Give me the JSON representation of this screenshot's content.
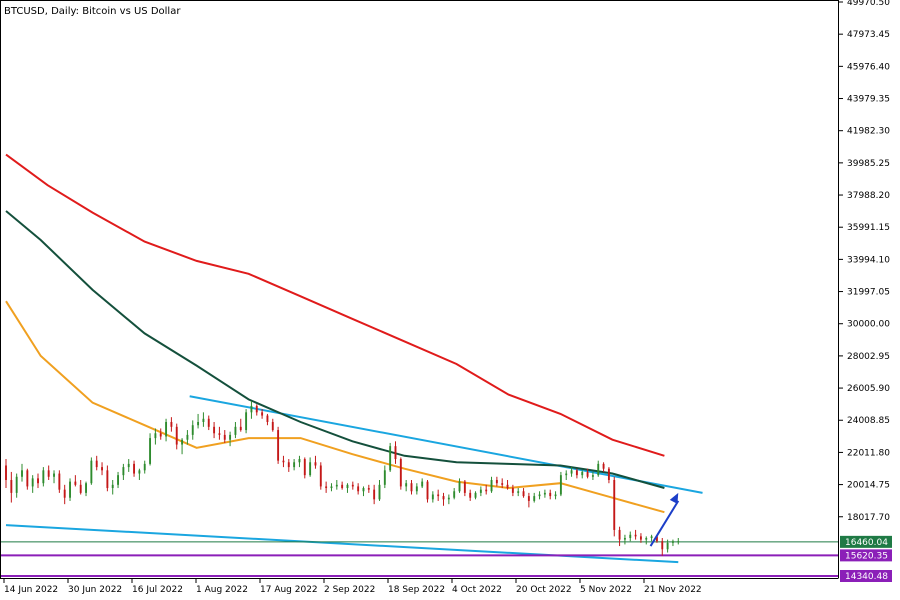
{
  "chart_data": {
    "type": "candlestick",
    "title": "BTCUSD, Daily:  Bitcoin vs US Dollar",
    "ylim": [
      14340.48,
      49970.5
    ],
    "grid": false,
    "y_ticks": [
      "49970.50",
      "47973.45",
      "45976.40",
      "43979.35",
      "41982.30",
      "39985.25",
      "37988.20",
      "35991.15",
      "33994.10",
      "31997.05",
      "30000.00",
      "28002.95",
      "26005.90",
      "24008.85",
      "22011.80",
      "20014.75",
      "18017.70"
    ],
    "x_tick_labels": [
      "14 Jun 2022",
      "30 Jun 2022",
      "16 Jul 2022",
      "1 Aug 2022",
      "17 Aug 2022",
      "2 Sep 2022",
      "18 Sep 2022",
      "4 Oct 2022",
      "20 Oct 2022",
      "5 Nov 2022",
      "21 Nov 2022"
    ],
    "price_labels": [
      {
        "text": "16460.04",
        "value": 16460.04,
        "color": "#1f7a45"
      },
      {
        "text": "15620.35",
        "value": 15620.35,
        "color": "#8b1fb8"
      },
      {
        "text": "14340.48",
        "value": 14340.48,
        "color": "#8b1fb8"
      }
    ],
    "colors": {
      "bull": "#2e8b2e",
      "bear": "#c41818",
      "ma_red": "#e01b1b",
      "ma_dark": "#14503c",
      "ma_orange": "#f0a020",
      "trend": "#1aa6e0",
      "arrow": "#1c3ec8"
    },
    "candles_ohlc": [
      [
        21200,
        21600,
        19800,
        20300
      ],
      [
        20300,
        20800,
        18900,
        19500
      ],
      [
        19500,
        20700,
        19200,
        20500
      ],
      [
        20500,
        21300,
        20200,
        20900
      ],
      [
        20900,
        21000,
        19700,
        19900
      ],
      [
        19900,
        20600,
        19500,
        20400
      ],
      [
        20400,
        20700,
        19800,
        20100
      ],
      [
        20100,
        21100,
        19900,
        20900
      ],
      [
        20900,
        21200,
        20300,
        20500
      ],
      [
        20500,
        20900,
        20100,
        20700
      ],
      [
        20700,
        20900,
        19500,
        19700
      ],
      [
        19700,
        20000,
        18800,
        19200
      ],
      [
        19200,
        20400,
        19000,
        20200
      ],
      [
        20200,
        20600,
        19900,
        20000
      ],
      [
        20000,
        20300,
        19400,
        19500
      ],
      [
        19500,
        20200,
        19300,
        20100
      ],
      [
        20100,
        21700,
        20000,
        21500
      ],
      [
        21500,
        21800,
        20900,
        21100
      ],
      [
        21100,
        21400,
        20600,
        20900
      ],
      [
        20900,
        21200,
        19600,
        19800
      ],
      [
        19800,
        20300,
        19400,
        20000
      ],
      [
        20000,
        20800,
        19800,
        20600
      ],
      [
        20600,
        21300,
        20300,
        21100
      ],
      [
        21100,
        21600,
        20800,
        21300
      ],
      [
        21300,
        21500,
        20500,
        20700
      ],
      [
        20700,
        21000,
        20300,
        20900
      ],
      [
        20900,
        21500,
        20700,
        21300
      ],
      [
        21300,
        23200,
        21200,
        22900
      ],
      [
        22900,
        23500,
        22500,
        23200
      ],
      [
        23200,
        23500,
        22800,
        23000
      ],
      [
        23000,
        24100,
        22700,
        23900
      ],
      [
        23900,
        24200,
        23300,
        23600
      ],
      [
        23600,
        23800,
        22200,
        22500
      ],
      [
        22500,
        22900,
        21900,
        22800
      ],
      [
        22800,
        23400,
        22500,
        23100
      ],
      [
        23100,
        24000,
        22800,
        23700
      ],
      [
        23700,
        24400,
        23500,
        23900
      ],
      [
        23900,
        24500,
        23600,
        24100
      ],
      [
        24100,
        24300,
        23400,
        23600
      ],
      [
        23600,
        23900,
        22900,
        23200
      ],
      [
        23200,
        23600,
        22800,
        23100
      ],
      [
        23100,
        23400,
        22600,
        22800
      ],
      [
        22800,
        23300,
        22400,
        23100
      ],
      [
        23100,
        23900,
        22900,
        23600
      ],
      [
        23600,
        24100,
        23300,
        23400
      ],
      [
        23400,
        24700,
        23200,
        24500
      ],
      [
        24500,
        25200,
        24100,
        24900
      ],
      [
        24900,
        25000,
        24300,
        24500
      ],
      [
        24500,
        24700,
        24100,
        24300
      ],
      [
        24300,
        24400,
        23700,
        23900
      ],
      [
        23900,
        24100,
        23300,
        23400
      ],
      [
        23400,
        23600,
        21300,
        21500
      ],
      [
        21500,
        21800,
        21100,
        21400
      ],
      [
        21400,
        21600,
        20800,
        21100
      ],
      [
        21100,
        21600,
        20900,
        21400
      ],
      [
        21400,
        21800,
        21100,
        21600
      ],
      [
        21600,
        21700,
        20400,
        20600
      ],
      [
        20600,
        21700,
        20500,
        21400
      ],
      [
        21400,
        21800,
        21000,
        21200
      ],
      [
        21200,
        21400,
        19700,
        19900
      ],
      [
        19900,
        20200,
        19500,
        19800
      ],
      [
        19800,
        20100,
        19600,
        19900
      ],
      [
        19900,
        20300,
        19700,
        20000
      ],
      [
        20000,
        20200,
        19700,
        19800
      ],
      [
        19800,
        20100,
        19500,
        20000
      ],
      [
        20000,
        20200,
        19700,
        19900
      ],
      [
        19900,
        20100,
        19400,
        19600
      ],
      [
        19600,
        19900,
        19300,
        19800
      ],
      [
        19800,
        20000,
        19500,
        19700
      ],
      [
        19700,
        20000,
        18800,
        19100
      ],
      [
        19100,
        20300,
        19000,
        20000
      ],
      [
        20000,
        21200,
        19800,
        20900
      ],
      [
        20900,
        22600,
        20800,
        22400
      ],
      [
        22400,
        22700,
        21300,
        21600
      ],
      [
        21600,
        21700,
        19700,
        19900
      ],
      [
        19900,
        20300,
        19600,
        20100
      ],
      [
        20100,
        20300,
        19400,
        19600
      ],
      [
        19600,
        20100,
        19400,
        19900
      ],
      [
        19900,
        20400,
        19800,
        20200
      ],
      [
        20200,
        20300,
        18900,
        19100
      ],
      [
        19100,
        19600,
        18900,
        19400
      ],
      [
        19400,
        19700,
        19000,
        19300
      ],
      [
        19300,
        19500,
        18700,
        19100
      ],
      [
        19100,
        19400,
        18800,
        19200
      ],
      [
        19200,
        19800,
        19100,
        19600
      ],
      [
        19600,
        20400,
        19500,
        20200
      ],
      [
        20200,
        20300,
        19300,
        19500
      ],
      [
        19500,
        19700,
        19000,
        19200
      ],
      [
        19200,
        19600,
        19100,
        19500
      ],
      [
        19500,
        19900,
        19300,
        19700
      ],
      [
        19700,
        20000,
        19400,
        19600
      ],
      [
        19600,
        20500,
        19500,
        20300
      ],
      [
        20300,
        20500,
        19900,
        20100
      ],
      [
        20100,
        20400,
        19800,
        20000
      ],
      [
        20000,
        20300,
        19700,
        19800
      ],
      [
        19800,
        20000,
        19300,
        19500
      ],
      [
        19500,
        19800,
        19300,
        19600
      ],
      [
        19600,
        19800,
        19200,
        19300
      ],
      [
        19300,
        19500,
        18600,
        19000
      ],
      [
        19000,
        19500,
        18900,
        19300
      ],
      [
        19300,
        19600,
        19100,
        19400
      ],
      [
        19400,
        19700,
        19200,
        19500
      ],
      [
        19500,
        19700,
        19100,
        19300
      ],
      [
        19300,
        19600,
        19100,
        19400
      ],
      [
        19400,
        20800,
        19300,
        20600
      ],
      [
        20600,
        20900,
        20300,
        20700
      ],
      [
        20700,
        21100,
        20500,
        20900
      ],
      [
        20900,
        21000,
        20400,
        20600
      ],
      [
        20600,
        20900,
        20400,
        20800
      ],
      [
        20800,
        21000,
        20400,
        20500
      ],
      [
        20500,
        20800,
        20300,
        20600
      ],
      [
        20600,
        21500,
        20500,
        21300
      ],
      [
        21300,
        21400,
        20800,
        21000
      ],
      [
        21000,
        21100,
        20100,
        20300
      ],
      [
        20300,
        20500,
        16800,
        17200
      ],
      [
        17200,
        17400,
        16200,
        16600
      ],
      [
        16600,
        16900,
        16300,
        16700
      ],
      [
        16700,
        17100,
        16500,
        16900
      ],
      [
        16900,
        17200,
        16600,
        16800
      ],
      [
        16800,
        17000,
        16400,
        16600
      ],
      [
        16600,
        16800,
        16300,
        16700
      ],
      [
        16700,
        16900,
        16500,
        16800
      ],
      [
        16800,
        16900,
        16400,
        16500
      ],
      [
        16500,
        16700,
        15600,
        16000
      ],
      [
        16000,
        16600,
        15800,
        16400
      ],
      [
        16400,
        16600,
        16200,
        16500
      ],
      [
        16500,
        16700,
        16300,
        16500
      ]
    ],
    "indicators": [
      {
        "color_key": "ma_red",
        "points": [
          [
            0,
            40500
          ],
          [
            12,
            38600
          ],
          [
            25,
            36900
          ],
          [
            40,
            35100
          ],
          [
            55,
            33900
          ],
          [
            70,
            33100
          ],
          [
            85,
            31700
          ],
          [
            100,
            30300
          ],
          [
            115,
            28900
          ],
          [
            130,
            27500
          ],
          [
            145,
            25600
          ],
          [
            160,
            24400
          ],
          [
            175,
            22800
          ],
          [
            190,
            21800
          ]
        ]
      },
      {
        "color_key": "ma_dark",
        "points": [
          [
            0,
            37000
          ],
          [
            10,
            35200
          ],
          [
            25,
            32100
          ],
          [
            40,
            29400
          ],
          [
            55,
            27400
          ],
          [
            70,
            25300
          ],
          [
            85,
            23900
          ],
          [
            100,
            22700
          ],
          [
            115,
            21800
          ],
          [
            130,
            21400
          ],
          [
            145,
            21300
          ],
          [
            160,
            21200
          ],
          [
            175,
            20700
          ],
          [
            190,
            19800
          ]
        ]
      },
      {
        "color_key": "ma_orange",
        "points": [
          [
            0,
            31400
          ],
          [
            10,
            28000
          ],
          [
            25,
            25100
          ],
          [
            40,
            23700
          ],
          [
            55,
            22300
          ],
          [
            70,
            22900
          ],
          [
            85,
            22900
          ],
          [
            100,
            21900
          ],
          [
            115,
            21000
          ],
          [
            130,
            20200
          ],
          [
            145,
            19800
          ],
          [
            160,
            20100
          ],
          [
            175,
            19200
          ],
          [
            190,
            18300
          ]
        ]
      }
    ],
    "trendlines": [
      {
        "color_key": "trend",
        "points": [
          [
            53,
            25500
          ],
          [
            201,
            19500
          ]
        ]
      },
      {
        "color_key": "trend",
        "points": [
          [
            0,
            17500
          ],
          [
            194,
            15200
          ]
        ]
      }
    ],
    "horizontal_lines": [
      {
        "value": 16460.04,
        "color_key": "ma_dark"
      },
      {
        "value": 15620.35,
        "color_key": "bear"
      },
      {
        "value": 14340.48,
        "color_key": "bear"
      }
    ],
    "arrow": {
      "from": [
        186,
        16200
      ],
      "to": [
        194,
        19500
      ],
      "color_key": "arrow"
    }
  }
}
